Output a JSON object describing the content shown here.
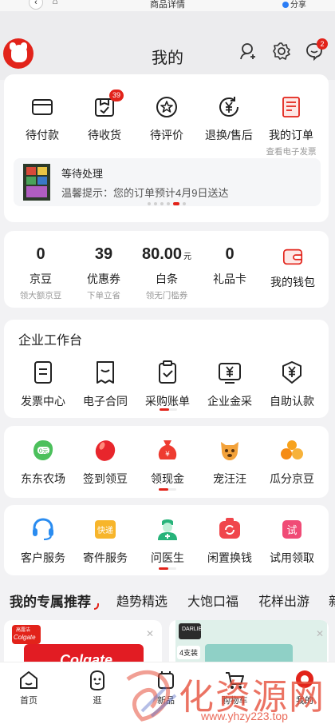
{
  "browser": {
    "title": "商品详情",
    "share_label": "分享",
    "back_icon": "back-icon",
    "home_icon": "home-icon"
  },
  "header": {
    "title": "我的",
    "message_badge": "2"
  },
  "orders": {
    "items": [
      {
        "label": "待付款",
        "icon": "card-icon"
      },
      {
        "label": "待收货",
        "icon": "package-icon",
        "badge": "39"
      },
      {
        "label": "待评价",
        "icon": "review-icon"
      },
      {
        "label": "退换/售后",
        "icon": "refund-icon"
      },
      {
        "label": "我的订单",
        "sub": "查看电子发票",
        "icon": "order-list-icon"
      }
    ],
    "pending": {
      "title": "等待处理",
      "text": "温馨提示：您的订单预计4月9日送达"
    }
  },
  "wallet": {
    "items": [
      {
        "value": "0",
        "label": "京豆",
        "sub": "领大额京豆"
      },
      {
        "value": "39",
        "label": "优惠券",
        "sub": "下单立省"
      },
      {
        "value": "80.00",
        "unit": "元",
        "label": "白条",
        "sub": "领无门槛券"
      },
      {
        "value": "0",
        "label": "礼品卡",
        "sub": ""
      }
    ],
    "my_wallet": "我的钱包"
  },
  "enterprise": {
    "title": "企业工作台",
    "items": [
      {
        "label": "发票中心",
        "icon": "invoice-icon"
      },
      {
        "label": "电子合同",
        "icon": "contract-icon"
      },
      {
        "label": "采购账单",
        "icon": "bill-icon"
      },
      {
        "label": "企业金采",
        "icon": "finance-icon"
      },
      {
        "label": "自助认款",
        "icon": "claim-icon"
      }
    ]
  },
  "fun": {
    "items": [
      {
        "label": "东东农场",
        "icon": "farm-icon",
        "tag": "0元"
      },
      {
        "label": "签到领豆",
        "icon": "bean-icon"
      },
      {
        "label": "领现金",
        "icon": "cash-bag-icon"
      },
      {
        "label": "宠汪汪",
        "icon": "dog-icon"
      },
      {
        "label": "瓜分京豆",
        "icon": "beans-pile-icon"
      }
    ]
  },
  "services": {
    "items": [
      {
        "label": "客户服务",
        "icon": "headset-icon"
      },
      {
        "label": "寄件服务",
        "icon": "express-icon",
        "tag": "快递"
      },
      {
        "label": "问医生",
        "icon": "doctor-icon"
      },
      {
        "label": "闲置换钱",
        "icon": "recycle-icon"
      },
      {
        "label": "试用领取",
        "icon": "trial-icon",
        "tag": "试"
      }
    ]
  },
  "feed_tabs": [
    "我的专属推荐",
    "趋势精选",
    "大饱口福",
    "花样出游",
    "新"
  ],
  "products": [
    {
      "brand": "Colgate",
      "brand_cn": "高露洁"
    },
    {
      "brand": "DARLIE",
      "tag": "4支装"
    }
  ],
  "bottom_nav": [
    {
      "label": "首页",
      "icon": "home-nav-icon"
    },
    {
      "label": "逛",
      "icon": "browse-icon"
    },
    {
      "label": "新品",
      "icon": "new-icon"
    },
    {
      "label": "购物车",
      "icon": "cart-icon"
    },
    {
      "label": "我的",
      "icon": "me-icon"
    }
  ],
  "watermark": {
    "text": "化资源网",
    "url": "www.yhzy223.top"
  },
  "colors": {
    "accent": "#e2231a",
    "bg": "#f2f2f4"
  }
}
